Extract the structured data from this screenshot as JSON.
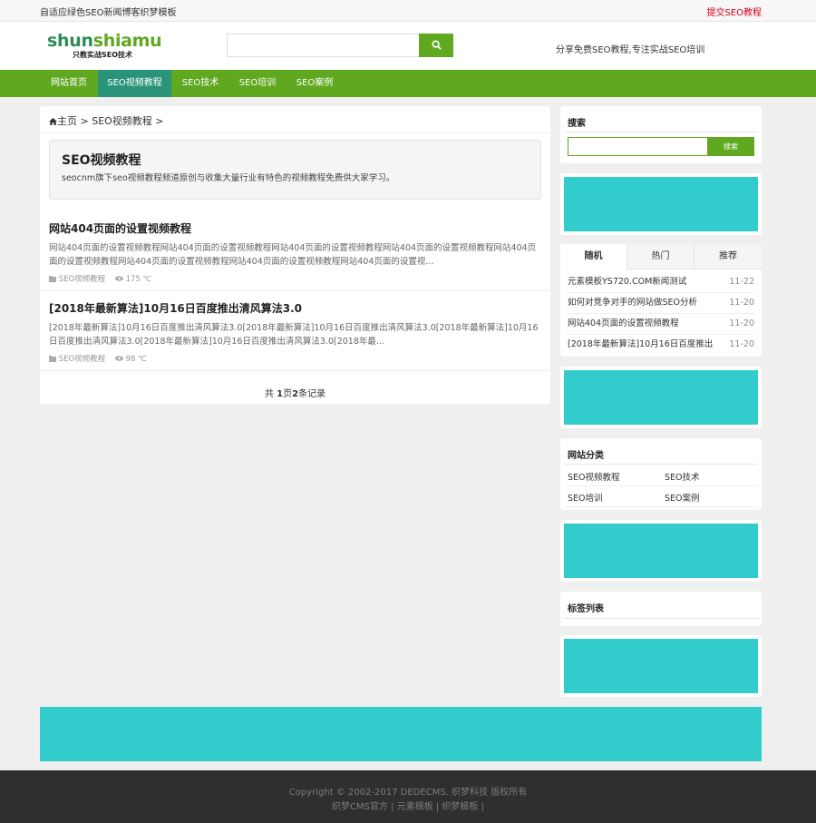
{
  "topbar": {
    "left": "自适应绿色SEO新闻博客织梦模板",
    "right": "提交SEO教程"
  },
  "header": {
    "brand_a": "shun",
    "brand_b": "shiamu",
    "slogan": "只教实战SEO技术",
    "search_placeholder": "",
    "tagline": "分享免费SEO教程,专注实战SEO培训"
  },
  "nav": {
    "items": [
      {
        "label": "网站首页",
        "active": false
      },
      {
        "label": "SEO视频教程",
        "active": true
      },
      {
        "label": "SEO技术",
        "active": false
      },
      {
        "label": "SEO培训",
        "active": false
      },
      {
        "label": "SEO案例",
        "active": false
      }
    ]
  },
  "main": {
    "crumb_home": "主页",
    "crumb_rest": " > SEO视频教程 >",
    "category": {
      "title": "SEO视频教程",
      "desc": "seocnm旗下seo视频教程频道原创与收集大量行业有特色的视频教程免费供大家学习。"
    },
    "posts": [
      {
        "title": "网站404页面的设置视频教程",
        "excerpt": "网站404页面的设置视频教程网站404页面的设置视频教程网站404页面的设置视频教程网站404页面的设置视频教程网站404页面的设置视频教程网站404页面的设置视频教程网站404页面的设置视频教程网站404页面的设置视...",
        "category": "SEO视频教程",
        "views": "175 ℃"
      },
      {
        "title": "[2018年最新算法]10月16日百度推出清风算法3.0",
        "excerpt": "[2018年最新算法]10月16日百度推出清风算法3.0[2018年最新算法]10月16日百度推出清风算法3.0[2018年最新算法]10月16日百度推出清风算法3.0[2018年最新算法]10月16日百度推出清风算法3.0[2018年最...",
        "category": "SEO视频教程",
        "views": "98 ℃"
      }
    ],
    "pager": {
      "prefix": "共 ",
      "pages": "1",
      "mid": "页",
      "records": "2",
      "suffix": "条记录"
    }
  },
  "sidebar": {
    "search": {
      "title": "搜索",
      "button": "搜索",
      "placeholder": ""
    },
    "tabs": [
      "随机",
      "热门",
      "推荐"
    ],
    "tab_list": [
      {
        "title": "元素模板YS720.COM新闻测试",
        "date": "11-22"
      },
      {
        "title": "如何对竞争对手的网站做SEO分析",
        "date": "11-20"
      },
      {
        "title": "网站404页面的设置视频教程",
        "date": "11-20"
      },
      {
        "title": "[2018年最新算法]10月16日百度推出",
        "date": "11-20"
      }
    ],
    "categories": {
      "title": "网站分类",
      "items": [
        "SEO视频教程",
        "SEO技术",
        "SEO培训",
        "SEO案例"
      ]
    },
    "tags": {
      "title": "标签列表"
    }
  },
  "footer": {
    "line1": "Copyright © 2002-2017 DEDECMS. 织梦科技 版权所有",
    "links": [
      "织梦CMS官方",
      "元素模板",
      "织梦模板"
    ]
  },
  "colors": {
    "green": "#5fa820",
    "teal_active": "#2a9478",
    "ad_teal": "#33cccc",
    "footer_bg": "#2d2f31"
  }
}
